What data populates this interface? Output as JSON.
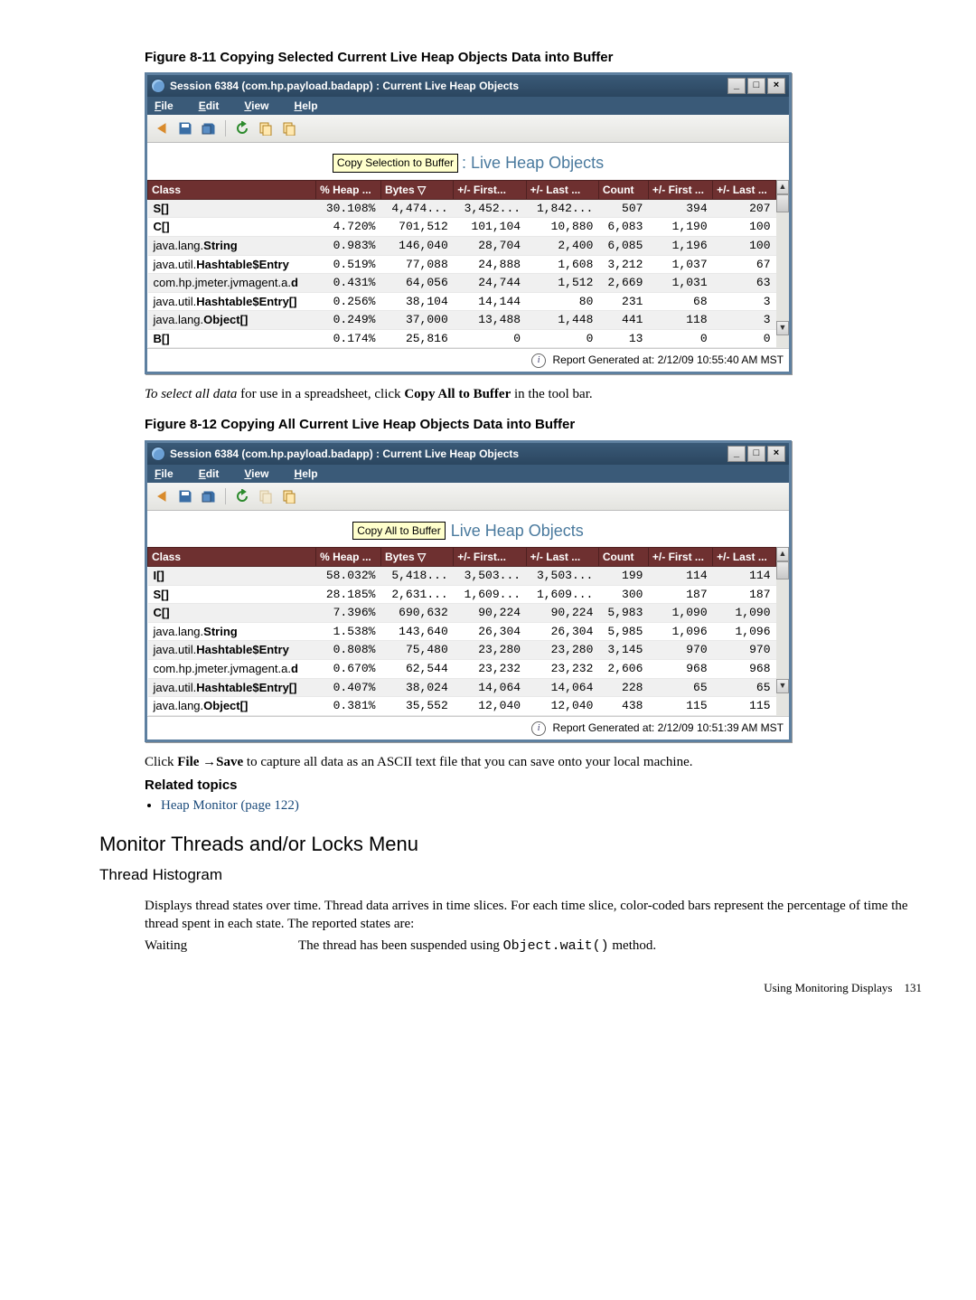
{
  "fig1": {
    "caption": "Figure 8-11 Copying Selected Current Live Heap Objects Data into Buffer",
    "title": "Session 6384 (com.hp.payload.badapp) : Current Live Heap Objects",
    "menus": {
      "file": "File",
      "edit": "Edit",
      "view": "View",
      "help": "Help"
    },
    "tooltip": "Copy Selection to Buffer",
    "heap_title": ": Live Heap Objects",
    "columns": [
      "Class",
      "% Heap ...",
      "Bytes ▽",
      "+/- First...",
      "+/- Last ...",
      "Count",
      "+/- First ...",
      "+/- Last ..."
    ],
    "rows": [
      {
        "cls": "S[]",
        "cls_bold": "S[]",
        "pct": "30.108%",
        "bytes": "4,474...",
        "d1": "3,452...",
        "d2": "1,842...",
        "cnt": "507",
        "c1": "394",
        "c2": "207"
      },
      {
        "cls": "C[]",
        "cls_bold": "C[]",
        "pct": "4.720%",
        "bytes": "701,512",
        "d1": "101,104",
        "d2": "10,880",
        "cnt": "6,083",
        "c1": "1,190",
        "c2": "100"
      },
      {
        "cls": "java.lang.String",
        "cls_bold": "String",
        "pct": "0.983%",
        "bytes": "146,040",
        "d1": "28,704",
        "d2": "2,400",
        "cnt": "6,085",
        "c1": "1,196",
        "c2": "100"
      },
      {
        "cls": "java.util.Hashtable$Entry",
        "cls_bold": "Hashtable$Entry",
        "pct": "0.519%",
        "bytes": "77,088",
        "d1": "24,888",
        "d2": "1,608",
        "cnt": "3,212",
        "c1": "1,037",
        "c2": "67"
      },
      {
        "cls": "com.hp.jmeter.jvmagent.a.d",
        "cls_bold": "d",
        "pct": "0.431%",
        "bytes": "64,056",
        "d1": "24,744",
        "d2": "1,512",
        "cnt": "2,669",
        "c1": "1,031",
        "c2": "63"
      },
      {
        "cls": "java.util.Hashtable$Entry[]",
        "cls_bold": "Hashtable$Entry[]",
        "pct": "0.256%",
        "bytes": "38,104",
        "d1": "14,144",
        "d2": "80",
        "cnt": "231",
        "c1": "68",
        "c2": "3"
      },
      {
        "cls": "java.lang.Object[]",
        "cls_bold": "Object[]",
        "pct": "0.249%",
        "bytes": "37,000",
        "d1": "13,488",
        "d2": "1,448",
        "cnt": "441",
        "c1": "118",
        "c2": "3"
      },
      {
        "cls": "B[]",
        "cls_bold": "B[]",
        "pct": "0.174%",
        "bytes": "25,816",
        "d1": "0",
        "d2": "0",
        "cnt": "13",
        "c1": "0",
        "c2": "0"
      }
    ],
    "status": "Report Generated at: 2/12/09 10:55:40 AM MST"
  },
  "mid_text": {
    "pre_italic": "To select all data",
    "rest": " for use in a spreadsheet, click ",
    "bold": "Copy All to Buffer",
    "tail": "  in the tool bar."
  },
  "fig2": {
    "caption": "Figure 8-12 Copying All Current Live Heap Objects Data into Buffer",
    "title": "Session 6384 (com.hp.payload.badapp) : Current Live Heap Objects",
    "menus": {
      "file": "File",
      "edit": "Edit",
      "view": "View",
      "help": "Help"
    },
    "tooltip": "Copy All to Buffer",
    "heap_title": "Live Heap Objects",
    "columns": [
      "Class",
      "% Heap ...",
      "Bytes ▽",
      "+/- First...",
      "+/- Last ...",
      "Count",
      "+/- First ...",
      "+/- Last ..."
    ],
    "rows": [
      {
        "cls": "I[]",
        "cls_bold": "I[]",
        "pct": "58.032%",
        "bytes": "5,418...",
        "d1": "3,503...",
        "d2": "3,503...",
        "cnt": "199",
        "c1": "114",
        "c2": "114"
      },
      {
        "cls": "S[]",
        "cls_bold": "S[]",
        "pct": "28.185%",
        "bytes": "2,631...",
        "d1": "1,609...",
        "d2": "1,609...",
        "cnt": "300",
        "c1": "187",
        "c2": "187"
      },
      {
        "cls": "C[]",
        "cls_bold": "C[]",
        "pct": "7.396%",
        "bytes": "690,632",
        "d1": "90,224",
        "d2": "90,224",
        "cnt": "5,983",
        "c1": "1,090",
        "c2": "1,090"
      },
      {
        "cls": "java.lang.String",
        "cls_bold": "String",
        "pct": "1.538%",
        "bytes": "143,640",
        "d1": "26,304",
        "d2": "26,304",
        "cnt": "5,985",
        "c1": "1,096",
        "c2": "1,096"
      },
      {
        "cls": "java.util.Hashtable$Entry",
        "cls_bold": "Hashtable$Entry",
        "pct": "0.808%",
        "bytes": "75,480",
        "d1": "23,280",
        "d2": "23,280",
        "cnt": "3,145",
        "c1": "970",
        "c2": "970"
      },
      {
        "cls": "com.hp.jmeter.jvmagent.a.d",
        "cls_bold": "d",
        "pct": "0.670%",
        "bytes": "62,544",
        "d1": "23,232",
        "d2": "23,232",
        "cnt": "2,606",
        "c1": "968",
        "c2": "968"
      },
      {
        "cls": "java.util.Hashtable$Entry[]",
        "cls_bold": "Hashtable$Entry[]",
        "pct": "0.407%",
        "bytes": "38,024",
        "d1": "14,064",
        "d2": "14,064",
        "cnt": "228",
        "c1": "65",
        "c2": "65"
      },
      {
        "cls": "java.lang.Object[]",
        "cls_bold": "Object[]",
        "pct": "0.381%",
        "bytes": "35,552",
        "d1": "12,040",
        "d2": "12,040",
        "cnt": "438",
        "c1": "115",
        "c2": "115"
      }
    ],
    "status": "Report Generated at: 2/12/09 10:51:39 AM MST"
  },
  "after_text": {
    "pre": "Click ",
    "b1": "File",
    "arrow": " →",
    "b2": "Save",
    "tail": " to capture all data as an ASCII text file that you can save onto your local machine."
  },
  "related": {
    "heading": "Related topics",
    "link": "Heap Monitor (page 122)"
  },
  "section": {
    "h2": "Monitor Threads and/or Locks Menu",
    "h3": "Thread Histogram",
    "para": "Displays thread states over time. Thread data arrives in time slices. For each time slice, color-coded bars represent the percentage of time the thread spent in each state. The reported states are:",
    "term": "Waiting",
    "def_pre": "The thread has been suspended using ",
    "def_code": "Object.wait()",
    "def_post": " method."
  },
  "footer": {
    "text": "Using Monitoring Displays",
    "page": "131"
  }
}
